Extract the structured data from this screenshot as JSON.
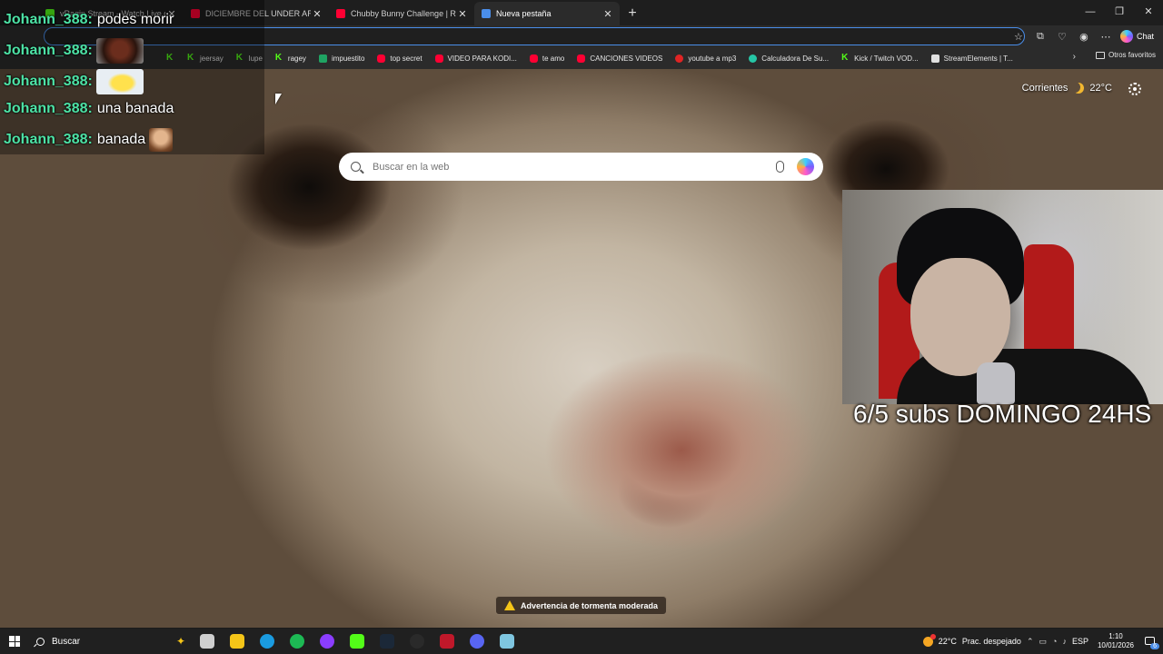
{
  "browser": {
    "tabs": [
      {
        "title": "vRagin Stream - Watch Live o",
        "color": "#53fc18"
      },
      {
        "title": "DICIEMBRE DEL UNDER ARGE",
        "color": "#ff0033"
      },
      {
        "title": "Chubby Bunny Challenge | Reto In",
        "color": "#ff0033"
      },
      {
        "title": "Nueva pestaña",
        "color": "#4a8eea"
      }
    ],
    "close_glyph": "✕",
    "new_tab_glyph": "+",
    "window_controls": {
      "minimize": "—",
      "maximize": "❐",
      "close": "✕"
    },
    "toolbar": {
      "chat_label": "Chat"
    },
    "bookmarks": [
      {
        "label": "",
        "icon": "kick-icon",
        "color": "#53fc18"
      },
      {
        "label": "jeersay",
        "icon": "kick-icon",
        "color": "#53fc18"
      },
      {
        "label": "lupe",
        "icon": "kick-icon",
        "color": "#53fc18"
      },
      {
        "label": "ragey",
        "icon": "kick-icon",
        "color": "#53fc18"
      },
      {
        "label": "impuestito",
        "icon": "sheet-icon",
        "color": "#1fa463"
      },
      {
        "label": "top secret",
        "icon": "youtube-icon",
        "color": "#ff0033"
      },
      {
        "label": "VIDEO PARA KODI...",
        "icon": "youtube-icon",
        "color": "#ff0033"
      },
      {
        "label": "te amo",
        "icon": "youtube-icon",
        "color": "#ff0033"
      },
      {
        "label": "CANCIONES VIDEOS",
        "icon": "youtube-icon",
        "color": "#ff0033"
      },
      {
        "label": "youtube a mp3",
        "icon": "converter-icon",
        "color": "#e02424"
      },
      {
        "label": "Calculadora De Su...",
        "icon": "calculator-icon",
        "color": "#26c6a6"
      },
      {
        "label": "Kick / Twitch VOD...",
        "icon": "kick-icon",
        "color": "#53fc18"
      },
      {
        "label": "StreamElements | T...",
        "icon": "streamelements-icon",
        "color": "#e0e0e0"
      }
    ],
    "more_bookmarks_glyph": "›",
    "other_favorites": "Otros favoritos"
  },
  "newtab": {
    "weather_location": "Corrientes",
    "weather_temp": "22°C",
    "search_placeholder": "Buscar en la web",
    "storm_alert": "Advertencia de tormenta moderada"
  },
  "stream_overlay": {
    "chat": [
      {
        "user": "Johann_388",
        "text": "podes morir",
        "emote": ""
      },
      {
        "user": "Johann_388",
        "text": "",
        "emote": "face-emote"
      },
      {
        "user": "Johann_388",
        "text": "",
        "emote": "yellow-blob-emote"
      },
      {
        "user": "Johann_388",
        "text": "una banada",
        "emote": ""
      },
      {
        "user": "Johann_388",
        "text": "banada",
        "emote": "man-emote"
      }
    ],
    "sub_goal": "6/5 subs DOMINGO 24HS"
  },
  "taskbar": {
    "search_label": "Buscar",
    "apps": [
      {
        "name": "task-view-icon",
        "color": "#cfcfcf"
      },
      {
        "name": "file-explorer-icon",
        "color": "#f5c518"
      },
      {
        "name": "edge-icon",
        "color": "#1a9be0"
      },
      {
        "name": "spotify-icon",
        "color": "#1db954"
      },
      {
        "name": "canva-icon",
        "color": "#8b3dff"
      },
      {
        "name": "kick-icon",
        "color": "#53fc18"
      },
      {
        "name": "steam-icon",
        "color": "#1b2838"
      },
      {
        "name": "obs-icon",
        "color": "#2a2a2a"
      },
      {
        "name": "video-editor-icon",
        "color": "#c0182a"
      },
      {
        "name": "discord-icon",
        "color": "#5865f2"
      },
      {
        "name": "notepad-icon",
        "color": "#7fc6e0"
      }
    ],
    "weather_temp": "22°C",
    "weather_desc": "Prac. despejado",
    "language": "ESP",
    "time": "1:10",
    "date": "10/01/2026",
    "notification_count": "6"
  }
}
